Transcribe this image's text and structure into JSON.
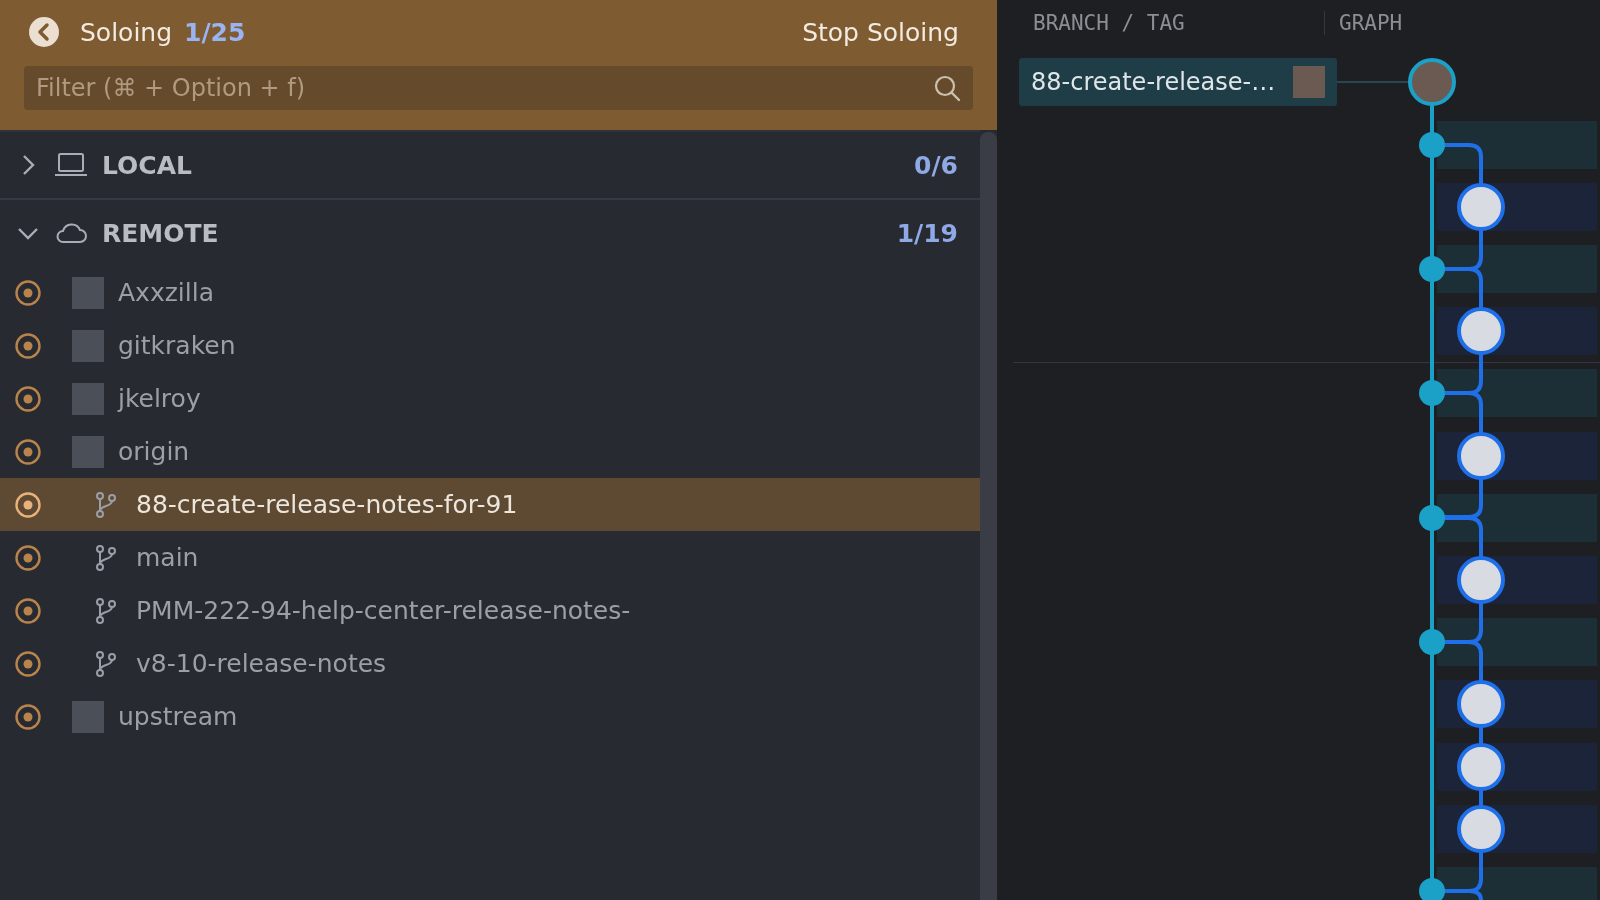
{
  "header": {
    "title": "Soloing",
    "count": "1/25",
    "stop_button": "Stop Soloing",
    "filter": {
      "placeholder": "Filter (⌘ + Option + f)"
    }
  },
  "sections": [
    {
      "label": "LOCAL",
      "kind": "local",
      "count": "0/6",
      "expanded": false
    },
    {
      "label": "REMOTE",
      "kind": "remote",
      "count": "1/19",
      "expanded": true,
      "items": [
        {
          "label": "Axxzilla",
          "kind": "remote",
          "selected": false
        },
        {
          "label": "gitkraken",
          "kind": "remote",
          "selected": false
        },
        {
          "label": "jkelroy",
          "kind": "remote",
          "selected": false
        },
        {
          "label": "origin",
          "kind": "remote",
          "selected": false,
          "children": [
            {
              "label": "88-create-release-notes-for-91",
              "kind": "branch",
              "selected": true
            },
            {
              "label": "main",
              "kind": "branch",
              "selected": false
            },
            {
              "label": "PMM-222-94-help-center-release-notes-",
              "kind": "branch",
              "selected": false
            },
            {
              "label": "v8-10-release-notes",
              "kind": "branch",
              "selected": false
            }
          ]
        },
        {
          "label": "upstream",
          "kind": "remote",
          "selected": false
        }
      ]
    }
  ],
  "graph": {
    "columns": [
      "BRANCH / TAG",
      "GRAPH"
    ],
    "branch_tag": "88-create-release-…"
  }
}
